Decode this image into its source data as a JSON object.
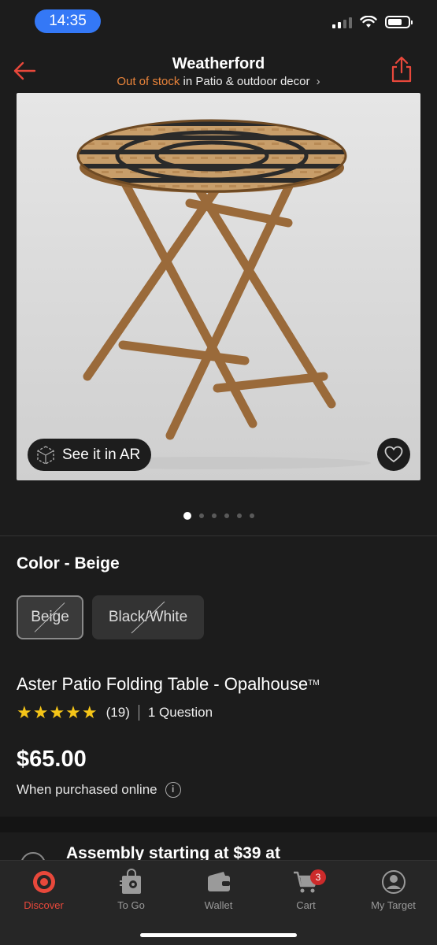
{
  "status_bar": {
    "time": "14:35"
  },
  "header": {
    "title": "Weatherford",
    "stock_status": "Out of stock",
    "category_text": "in Patio & outdoor decor"
  },
  "media": {
    "ar_label": "See it in AR",
    "dots_total": 6,
    "dots_active": 0
  },
  "color": {
    "label": "Color - Beige",
    "options": [
      {
        "label": "Beige",
        "selected": true,
        "unavailable": true
      },
      {
        "label": "Black/White",
        "selected": false,
        "unavailable": true
      }
    ]
  },
  "product": {
    "title": "Aster Patio Folding Table - Opalhouse",
    "trademark": "TM",
    "rating_stars": 5,
    "review_count": "(19)",
    "questions": "1 Question",
    "price": "$65.00",
    "price_note": "When purchased online"
  },
  "assembly": {
    "text": "Assembly starting at $39 at"
  },
  "tab_bar": {
    "tabs": [
      {
        "label": "Discover",
        "icon": "target-icon",
        "active": true
      },
      {
        "label": "To Go",
        "icon": "bag-icon",
        "active": false
      },
      {
        "label": "Wallet",
        "icon": "wallet-icon",
        "active": false
      },
      {
        "label": "Cart",
        "icon": "cart-icon",
        "active": false
      },
      {
        "label": "My Target",
        "icon": "profile-icon",
        "active": false
      }
    ],
    "cart_count": "3"
  },
  "colors": {
    "accent": "#e8483b",
    "out_of_stock": "#e8833a",
    "background": "#1c1c1c",
    "star": "#f5c518"
  }
}
